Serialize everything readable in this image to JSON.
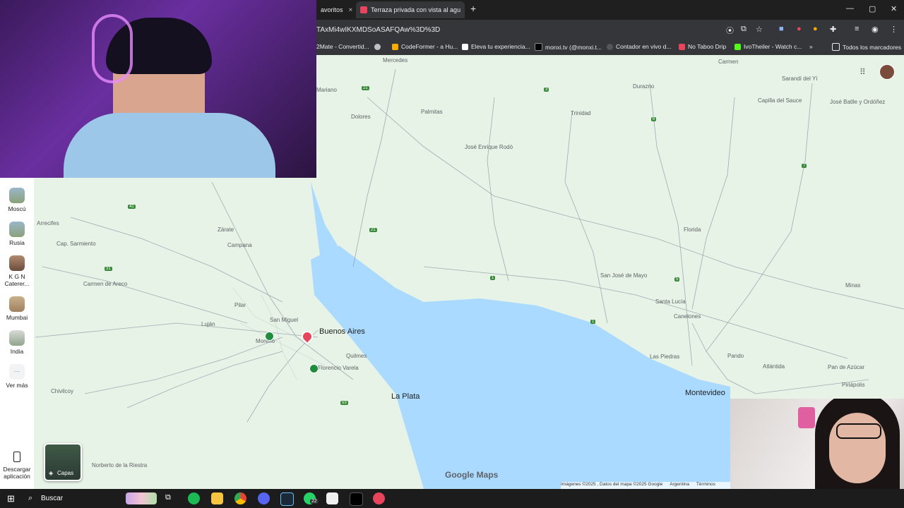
{
  "browser": {
    "tabs": [
      {
        "label": "avoritos",
        "close": "×"
      },
      {
        "label": "Terraza privada con vista al agu",
        "close": "×"
      }
    ],
    "new_tab": "+",
    "url": "TAxMi4wIKXMDSoASAFQAw%3D%3D",
    "window_controls": [
      "—",
      "▢",
      "✕"
    ],
    "bookmarks": [
      "2Mate - Convertid...",
      "CodeFormer - a Hu...",
      "Eleva tu experiencia...",
      "monxi.tv (@monxi.t...",
      "Contador en vivo d...",
      "No Taboo Drip",
      "IvoTheiler - Watch c...",
      "»",
      "Todos los marcadores"
    ]
  },
  "sidebar": {
    "items": [
      {
        "label": "Moscú"
      },
      {
        "label": "Rusia"
      },
      {
        "label": "K G N Caterer..."
      },
      {
        "label": "Mumbai"
      },
      {
        "label": "India"
      },
      {
        "label": "Ver más"
      }
    ],
    "download_label": "Descargar aplicación",
    "layers_label": "Capas"
  },
  "map": {
    "places_small": [
      "Mercedes",
      "Palmitas",
      "Dolores",
      "José Enrique Rodó",
      "Trinidad",
      "Durazno",
      "Carmen",
      "Sarandí del Yí",
      "Capilla del Sauce",
      "José Batlle y Ordóñez",
      "Florida",
      "San José de Mayo",
      "Santa Lucía",
      "Canelones",
      "Minas",
      "Las Piedras",
      "Pando",
      "Atlántida",
      "Pan de Azúcar",
      "Piriápolis",
      "Arrecifes",
      "Cap. Sarmiento",
      "Zárate",
      "Campana",
      "Carmen de Areco",
      "Pilar",
      "Luján",
      "San Miguel",
      "Moreno",
      "Quilmes",
      "Florencio Varela",
      "Chivilcoy",
      "Norberto de la Riestra",
      "Mariano"
    ],
    "places_big": [
      "Buenos Aires",
      "La Plata",
      "Montevideo"
    ],
    "logo": "Google Maps",
    "footer": [
      "Imágenes ©2025 , Datos del mapa ©2025 Google",
      "Argentina",
      "Términos"
    ]
  },
  "taskbar": {
    "search_label": "Buscar",
    "whatsapp_badge": "22"
  },
  "colors": {
    "water": "#aadaff",
    "land": "#e6f3e6",
    "road": "#8f9aa8",
    "accent": "#e7455b"
  }
}
